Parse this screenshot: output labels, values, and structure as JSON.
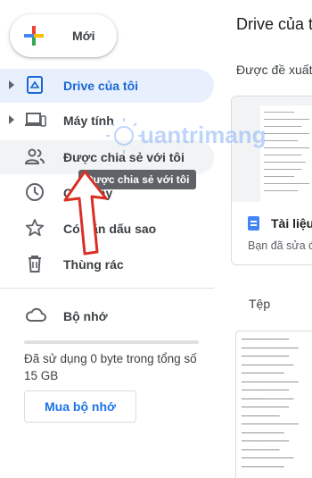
{
  "new_button": {
    "label": "Mới"
  },
  "sidebar": {
    "items": [
      {
        "label": "Drive của tôi",
        "icon": "drive-icon",
        "active": true
      },
      {
        "label": "Máy tính",
        "icon": "computer-icon"
      },
      {
        "label": "Được chia sẻ với tôi",
        "icon": "people-icon"
      },
      {
        "label": "Gần đây",
        "icon": "clock-icon"
      },
      {
        "label": "Có gắn dấu sao",
        "icon": "star-icon"
      },
      {
        "label": "Thùng rác",
        "icon": "trash-icon"
      }
    ],
    "storage_label": "Bộ nhớ",
    "storage_used": "Đã sử dụng 0 byte trong tổng số 15 GB",
    "buy_storage": "Mua bộ nhớ"
  },
  "tooltip": {
    "text": "Được chia sẻ với tôi"
  },
  "main": {
    "title": "Drive của tôi",
    "suggested_label": "Được đề xuất",
    "card": {
      "doc_name": "Tài liệu",
      "doc_sub": "Bạn đã sửa đổi"
    },
    "files_label": "Tệp"
  },
  "watermark": {
    "text": "uantrimang"
  },
  "colors": {
    "accent": "#1967d2",
    "active_bg": "#e8f0fe",
    "arrow": "#d93025"
  }
}
